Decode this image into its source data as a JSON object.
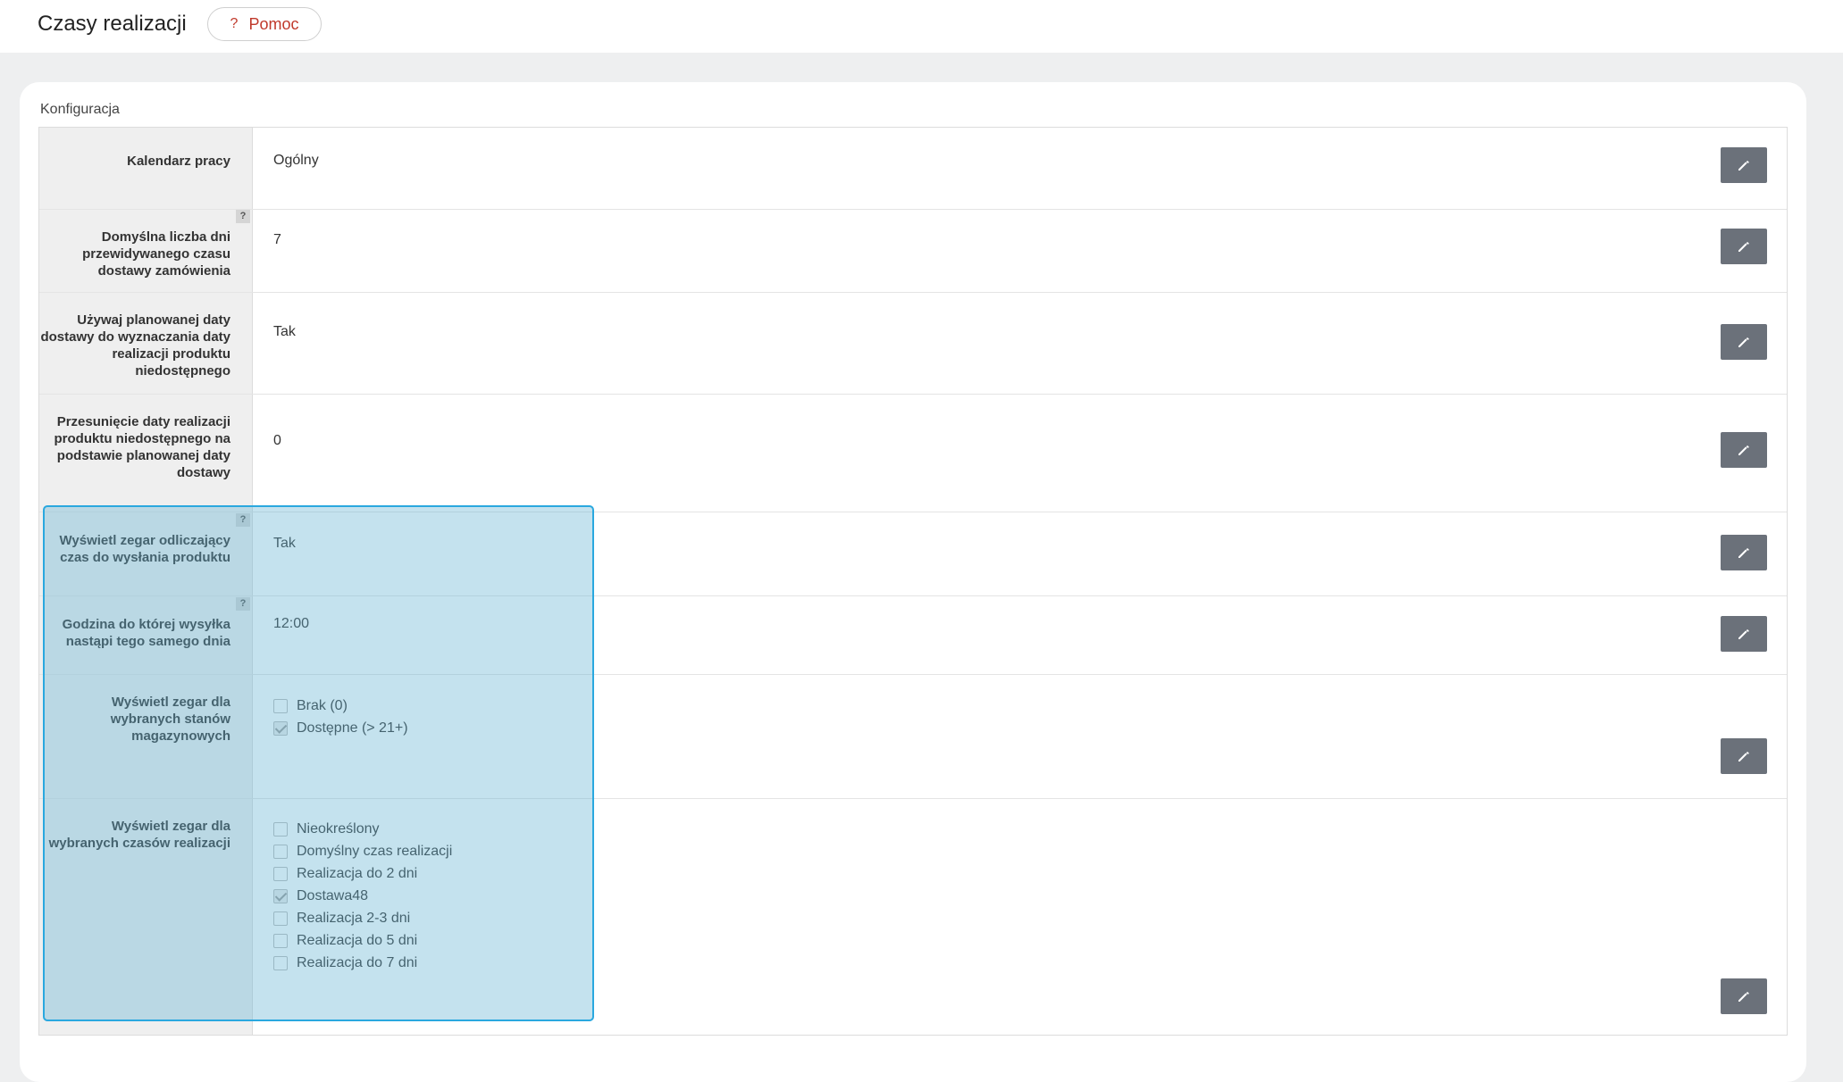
{
  "header": {
    "title": "Czasy realizacji",
    "help_label": "Pomoc",
    "help_icon": "?"
  },
  "section": {
    "label": "Konfiguracja"
  },
  "rows": [
    {
      "label": "Kalendarz pracy",
      "value": "Ogólny",
      "has_help": false
    },
    {
      "label": "Domyślna liczba dni przewidywanego czasu dostawy zamówienia",
      "value": "7",
      "has_help": true
    },
    {
      "label": "Używaj planowanej daty dostawy do wyznaczania daty realizacji produktu niedostępnego",
      "value": "Tak",
      "has_help": false
    },
    {
      "label": "Przesunięcie daty realizacji produktu niedostępnego na podstawie planowanej daty dostawy",
      "value": "0",
      "has_help": false
    },
    {
      "label": "Wyświetl zegar odliczający czas do wysłania produktu",
      "value": "Tak",
      "has_help": true
    },
    {
      "label": "Godzina do której wysyłka nastąpi tego samego dnia",
      "value": "12:00",
      "has_help": true
    },
    {
      "label": "Wyświetl zegar dla wybranych stanów magazynowych",
      "options": [
        {
          "label": "Brak (0)",
          "checked": false
        },
        {
          "label": "Dostępne (> 21+)",
          "checked": true
        }
      ]
    },
    {
      "label": "Wyświetl zegar dla wybranych czasów realizacji",
      "options": [
        {
          "label": "Nieokreślony",
          "checked": false
        },
        {
          "label": "Domyślny czas realizacji",
          "checked": false
        },
        {
          "label": "Realizacja do 2 dni",
          "checked": false
        },
        {
          "label": "Dostawa48",
          "checked": true
        },
        {
          "label": "Realizacja 2-3 dni",
          "checked": false
        },
        {
          "label": "Realizacja do 5 dni",
          "checked": false
        },
        {
          "label": "Realizacja do 7 dni",
          "checked": false
        }
      ]
    }
  ],
  "help_marker": "?",
  "icons": {
    "edit": "pencil-icon",
    "help": "question-icon"
  },
  "colors": {
    "accent": "#c0392b",
    "edit_button": "#6b717a",
    "highlight_border": "#2aa8df"
  }
}
